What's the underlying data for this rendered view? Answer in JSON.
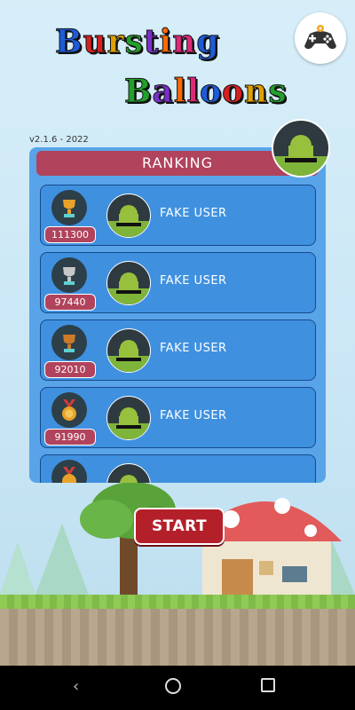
{
  "game": {
    "title_line1": "Bursting",
    "title_line2": "Balloons",
    "version": "v2.1.6 - 2022"
  },
  "ranking": {
    "header": "RANKING",
    "entries": [
      {
        "score": "111300",
        "name": "FAKE USER",
        "medal": "gold-trophy-icon"
      },
      {
        "score": "97440",
        "name": "FAKE USER",
        "medal": "silver-trophy-icon"
      },
      {
        "score": "92010",
        "name": "FAKE USER",
        "medal": "bronze-trophy-icon"
      },
      {
        "score": "91990",
        "name": "FAKE USER",
        "medal": "gold-medal-icon"
      },
      {
        "score": "",
        "name": "",
        "medal": "medal-icon"
      }
    ]
  },
  "start_label": "START",
  "colors": {
    "panel": "#59a4e8",
    "row": "#3f91e0",
    "accent_red": "#b1435c",
    "start_red": "#b4202a",
    "android_green": "#97c03d",
    "title_colors": [
      "#1e5bd8",
      "#d62020",
      "#e0a000",
      "#22a02a",
      "#7a30c8",
      "#ff6a00",
      "#e02878"
    ]
  }
}
